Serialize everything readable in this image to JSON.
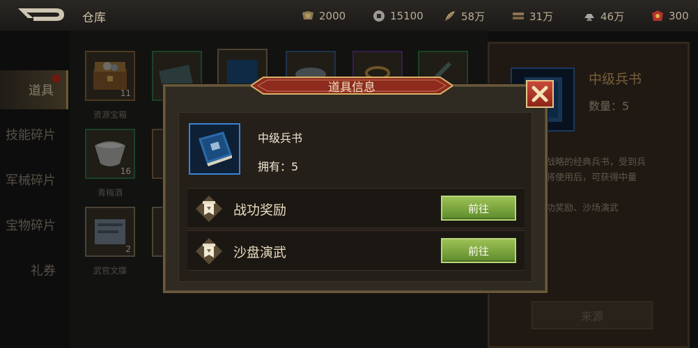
{
  "header": {
    "back_icon": "back-arrow-icon",
    "title": "仓库",
    "resources": [
      {
        "icon": "food-icon",
        "value": "2000"
      },
      {
        "icon": "coin-icon",
        "value": "15100"
      },
      {
        "icon": "feather-icon",
        "value": "58万"
      },
      {
        "icon": "wood-icon",
        "value": "31万"
      },
      {
        "icon": "iron-icon",
        "value": "46万"
      },
      {
        "icon": "treasure-icon",
        "value": "300"
      }
    ]
  },
  "sidebar": {
    "items": [
      {
        "label": "道具",
        "active": true
      },
      {
        "label": "技能碎片"
      },
      {
        "label": "军械碎片"
      },
      {
        "label": "宝物碎片"
      },
      {
        "label": "礼券"
      }
    ]
  },
  "inventory": {
    "items": [
      {
        "name": "资源宝箱",
        "count": "11"
      },
      {
        "name": "青梅酒",
        "count": "16"
      },
      {
        "name": "武官文牒",
        "count": "2"
      }
    ]
  },
  "detail": {
    "name": "中级兵书",
    "quantity": "数量：5",
    "description_lines": [
      "谋战略的经典兵书，受到兵",
      "武将使用后，可获得中量",
      "",
      "战功奖励、沙场演武"
    ],
    "source_button": "来源"
  },
  "dialog": {
    "title": "道具信息",
    "item_name": "中级兵书",
    "owned": "拥有：5",
    "rows": [
      {
        "label": "战功奖励",
        "button": "前往"
      },
      {
        "label": "沙盘演武",
        "button": "前往"
      }
    ]
  },
  "colors": {
    "accent_gold": "#c9a45c",
    "go_button_green": "#7ea840",
    "close_red": "#b03a2a",
    "item_border_blue": "#3b82d6"
  }
}
